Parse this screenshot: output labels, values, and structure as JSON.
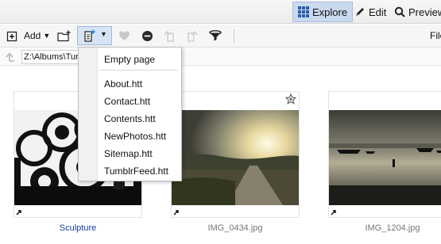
{
  "modes": {
    "explore": "Explore",
    "edit": "Edit",
    "preview": "Preview"
  },
  "toolbar": {
    "add_label": "Add",
    "file_label": "File"
  },
  "address": {
    "value": "Z:\\Albums\\Tur"
  },
  "menu": {
    "empty_page": "Empty page",
    "items": [
      "About.htt",
      "Contact.htt",
      "Contents.htt",
      "NewPhotos.htt",
      "Sitemap.htt",
      "TumblrFeed.htt"
    ]
  },
  "thumbnails": [
    {
      "caption": "Sculpture",
      "starred": false,
      "is_link": true
    },
    {
      "caption": "IMG_0434.jpg",
      "starred": true,
      "is_link": false
    },
    {
      "caption": "IMG_1204.jpg",
      "starred": false,
      "is_link": false
    }
  ],
  "colors": {
    "active_mode_bg": "#c9d9ee",
    "caption_link": "#1c3d9c",
    "caption_file": "#777777"
  }
}
